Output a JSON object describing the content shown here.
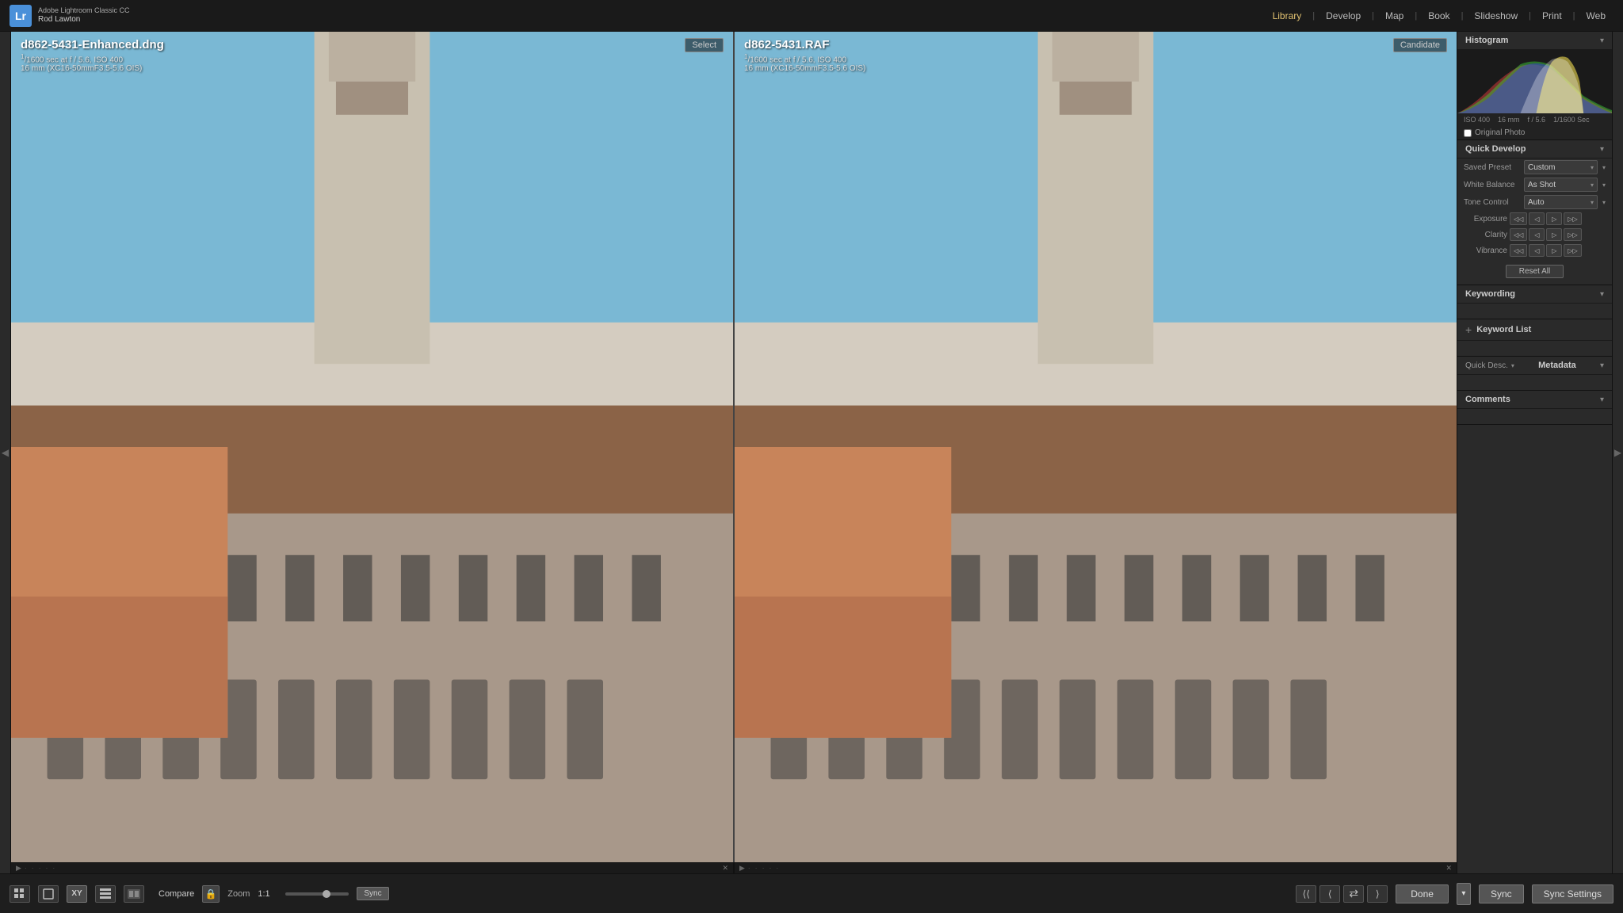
{
  "app": {
    "name_line1": "Adobe Lightroom Classic CC",
    "name_line2": "Rod Lawton",
    "logo": "Lr"
  },
  "nav": {
    "items": [
      {
        "label": "Library",
        "active": true
      },
      {
        "label": "Develop",
        "active": false
      },
      {
        "label": "Map",
        "active": false
      },
      {
        "label": "Book",
        "active": false
      },
      {
        "label": "Slideshow",
        "active": false
      },
      {
        "label": "Print",
        "active": false
      },
      {
        "label": "Web",
        "active": false
      }
    ]
  },
  "right_panel": {
    "histogram_label": "Histogram",
    "histogram_info": {
      "iso": "ISO 400",
      "focal": "16 mm",
      "aperture": "f / 5.6",
      "shutter": "1/1600 Sec"
    },
    "original_photo_label": "Original Photo",
    "quick_develop": {
      "title": "Quick Develop",
      "saved_preset_label": "Saved Preset",
      "saved_preset_value": "Custom",
      "white_balance_label": "White Balance",
      "white_balance_value": "As Shot",
      "tone_control_label": "Tone Control",
      "tone_control_value": "Auto",
      "exposure_label": "Exposure",
      "clarity_label": "Clarity",
      "vibrance_label": "Vibrance",
      "reset_all_label": "Reset All",
      "btn_dbl_left": "◁◁",
      "btn_left": "◁",
      "btn_right": "▷",
      "btn_dbl_right": "▷▷"
    },
    "keywording": {
      "title": "Keywording",
      "expand": "▾"
    },
    "keyword_list": {
      "title": "Keyword List",
      "expand": "+",
      "plus": "+"
    },
    "metadata": {
      "title": "Metadata",
      "expand": "▾",
      "quick_desc_label": "Quick Desc.",
      "quick_desc_arrow": "▾"
    },
    "comments": {
      "title": "Comments",
      "expand": "▾"
    }
  },
  "photos": {
    "left": {
      "filename": "d862-5431-Enhanced.dng",
      "shutter_num": "1",
      "shutter_den": "1600",
      "aperture": "f / 5.6",
      "iso": "ISO 400",
      "lens": "16 mm (XC16-50mmF3.5-5.6 OIS)",
      "badge": "Select"
    },
    "right": {
      "filename": "d862-5431.RAF",
      "shutter_num": "1",
      "shutter_den": "1600",
      "aperture": "f / 5.6",
      "iso": "ISO 400",
      "lens": "16 mm (XC16-50mmF3.5-5.6 OIS)",
      "badge": "Candidate"
    }
  },
  "bottom_bar": {
    "compare_label": "Compare",
    "zoom_label": "Zoom",
    "zoom_value": "1:1",
    "sync_small_label": "Sync",
    "done_label": "Done",
    "sync_main_label": "Sync",
    "sync_settings_label": "Sync Settings"
  },
  "toolbar": {
    "grid_icon": "⊞",
    "loupe_icon": "☐",
    "xy_icon": "XY",
    "strip_icon": "▤",
    "compare_icon": "⬛"
  }
}
